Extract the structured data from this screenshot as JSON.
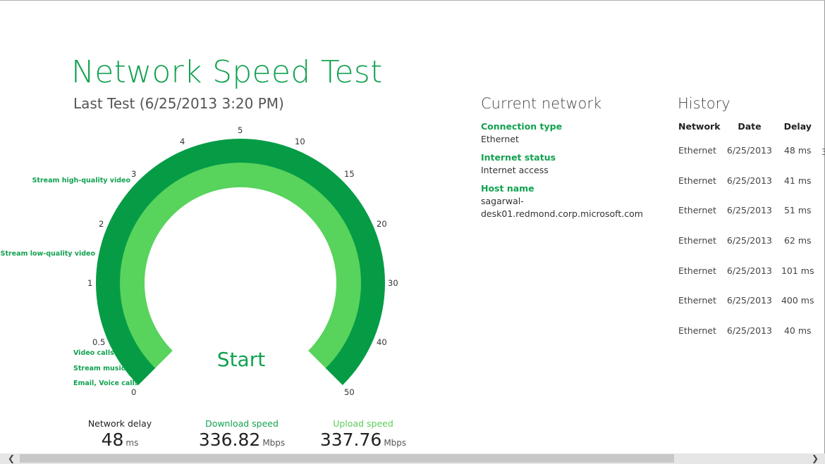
{
  "app": {
    "title": "Network Speed Test",
    "last_test": "Last Test (6/25/2013 3:20 PM)"
  },
  "gauge": {
    "ticks_left": [
      "0",
      "0.5",
      "1",
      "2",
      "3",
      "4",
      "5"
    ],
    "ticks_right": [
      "10",
      "15",
      "20",
      "30",
      "40",
      "50"
    ],
    "captions": [
      "Stream high-quality video",
      "Stream low-quality video",
      "Video calls",
      "Stream music",
      "Email, Voice calls"
    ],
    "start_label": "Start",
    "colors": {
      "outer": "#069c46",
      "inner": "#58d35c",
      "accent": "#12a150"
    }
  },
  "metrics": {
    "delay": {
      "label": "Network delay",
      "value": "48",
      "unit": "ms"
    },
    "download": {
      "label": "Download speed",
      "value": "336.82",
      "unit": "Mbps"
    },
    "upload": {
      "label": "Upload speed",
      "value": "337.76",
      "unit": "Mbps"
    }
  },
  "current_network": {
    "heading": "Current network",
    "fields": [
      {
        "key": "Connection type",
        "value": "Ethernet"
      },
      {
        "key": "Internet status",
        "value": "Internet access"
      },
      {
        "key": "Host name",
        "value": "sagarwal-desk01.redmond.corp.microsoft.com"
      }
    ]
  },
  "history": {
    "heading": "History",
    "columns": [
      "Network",
      "Date",
      "Delay"
    ],
    "rows": [
      [
        "Ethernet",
        "6/25/2013",
        "48 ms"
      ],
      [
        "Ethernet",
        "6/25/2013",
        "41 ms"
      ],
      [
        "Ethernet",
        "6/25/2013",
        "51 ms"
      ],
      [
        "Ethernet",
        "6/25/2013",
        "62 ms"
      ],
      [
        "Ethernet",
        "6/25/2013",
        "101 ms"
      ],
      [
        "Ethernet",
        "6/25/2013",
        "400 ms"
      ],
      [
        "Ethernet",
        "6/25/2013",
        "40 ms"
      ]
    ],
    "overflow_stub": "3"
  },
  "scrollbar": {
    "left_arrow": "❮",
    "right_arrow": "❯",
    "position": 0.0,
    "visible_fraction": 0.82
  }
}
